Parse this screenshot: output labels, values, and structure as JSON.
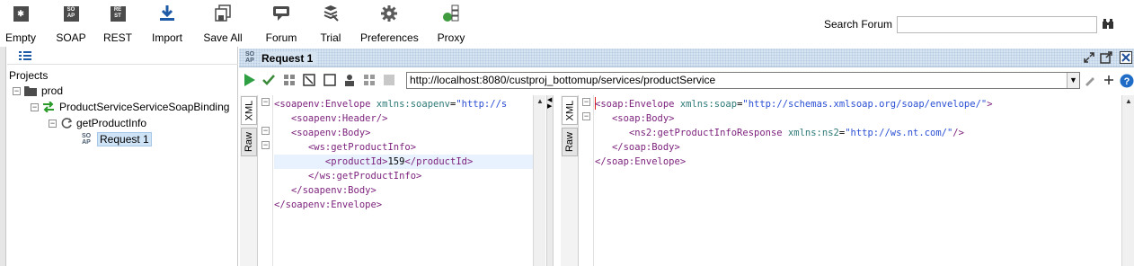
{
  "toolbar": {
    "buttons": [
      {
        "label": "Empty",
        "icon": "empty-project-icon"
      },
      {
        "label": "SOAP",
        "icon": "soap-project-icon",
        "icon_text": "SO AP"
      },
      {
        "label": "REST",
        "icon": "rest-project-icon",
        "icon_text": "RE ST"
      },
      {
        "label": "Import",
        "icon": "import-icon"
      },
      {
        "label": "Save All",
        "icon": "save-all-icon"
      },
      {
        "label": "Forum",
        "icon": "forum-icon"
      },
      {
        "label": "Trial",
        "icon": "trial-icon"
      },
      {
        "label": "Preferences",
        "icon": "preferences-gear-icon"
      },
      {
        "label": "Proxy",
        "icon": "proxy-icon"
      }
    ],
    "search_label": "Search Forum",
    "search_value": ""
  },
  "navigator": {
    "root_label": "Projects",
    "tree": [
      {
        "label": "prod",
        "icon": "folder-icon"
      },
      {
        "label": "ProductServiceServiceSoapBinding",
        "icon": "interface-icon"
      },
      {
        "label": "getProductInfo",
        "icon": "operation-icon"
      },
      {
        "label": "Request 1",
        "icon": "soap-request-icon",
        "icon_text": "SO AP"
      }
    ]
  },
  "request": {
    "title": "Request 1",
    "title_icon_text": "SO AP",
    "endpoint": "http://localhost:8080/custproj_bottomup/services/productService",
    "request_tabs": {
      "xml": "XML",
      "raw": "Raw"
    },
    "response_tabs": {
      "xml": "XML",
      "raw": "Raw"
    },
    "request_xml": [
      {
        "text": "<soapenv:Envelope xmlns:soapenv=\"http://s"
      },
      {
        "text": "   <soapenv:Header/>"
      },
      {
        "text": "   <soapenv:Body>"
      },
      {
        "text": "      <ws:getProductInfo>"
      },
      {
        "text": "         <productId>159</productId>"
      },
      {
        "text": "      </ws:getProductInfo>"
      },
      {
        "text": "   </soapenv:Body>"
      },
      {
        "text": "</soapenv:Envelope>"
      }
    ],
    "response_xml": [
      {
        "text": "<soap:Envelope xmlns:soap=\"http://schemas.xmlsoap.org/soap/envelope/\">"
      },
      {
        "text": "   <soap:Body>"
      },
      {
        "text": "      <ns2:getProductInfoResponse xmlns:ns2=\"http://ws.nt.com/\"/>"
      },
      {
        "text": "   </soap:Body>"
      },
      {
        "text": "</soap:Envelope>"
      }
    ]
  }
}
